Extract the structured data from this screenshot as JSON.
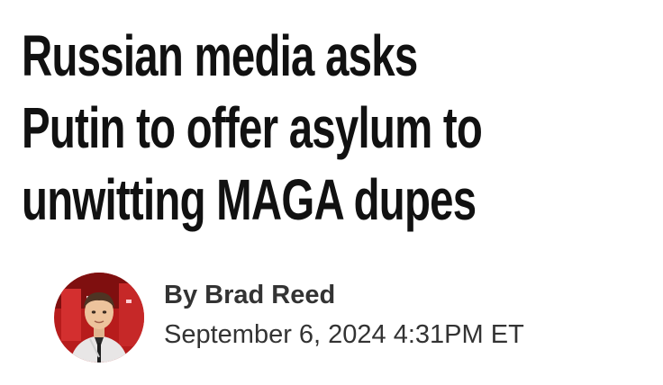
{
  "article": {
    "headline_lines": [
      "Russian media asks",
      "Putin to offer asylum to",
      "unwitting MAGA dupes"
    ],
    "author": "By Brad Reed",
    "date": "September 6, 2024 4:31PM ET",
    "avatar_icon": "author-photo"
  },
  "colors": {
    "headline": "#111111",
    "meta_text": "#333333",
    "avatar_background": "#c62828"
  }
}
